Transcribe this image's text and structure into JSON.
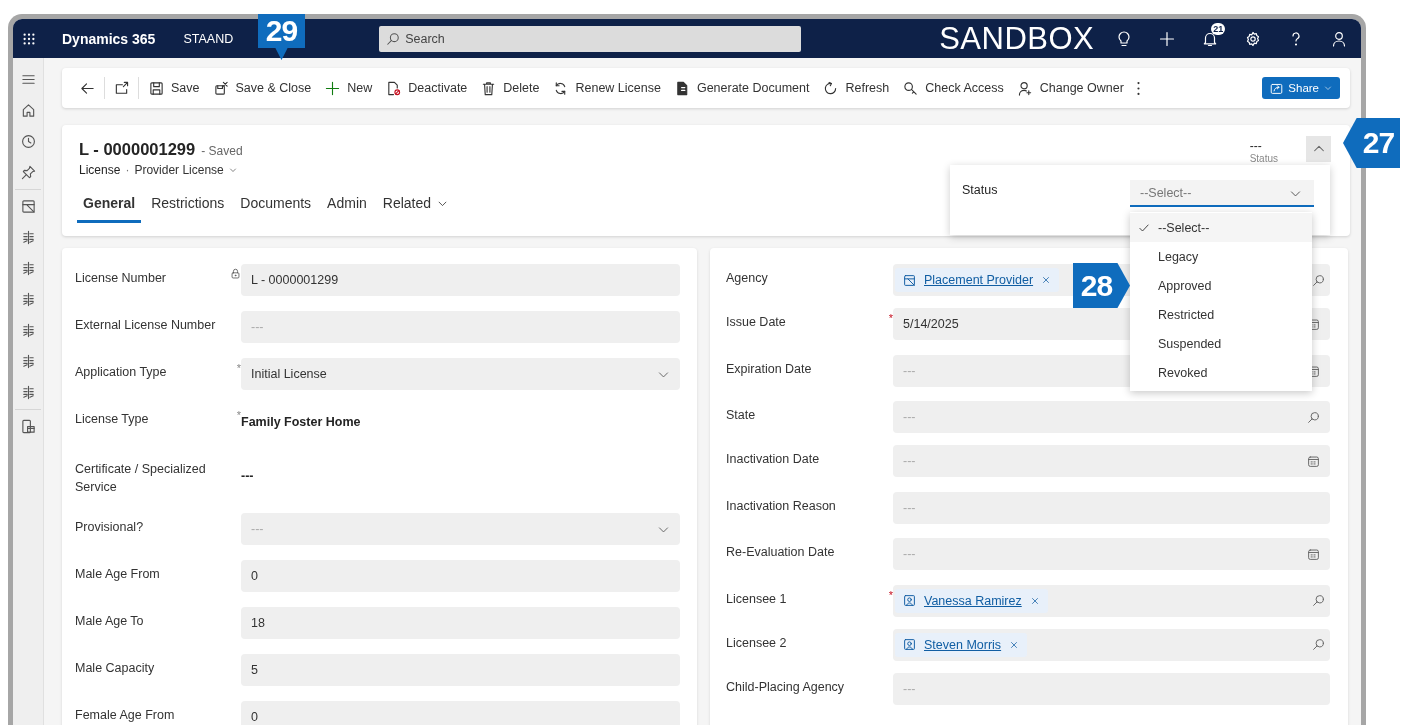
{
  "top_bar": {
    "app_name": "Dynamics 365",
    "environment": "STAAND",
    "search": {
      "placeholder": "Search"
    },
    "banner": "SANDBOX",
    "notification_count": "21"
  },
  "command_bar": {
    "commands": [
      {
        "label": "Save"
      },
      {
        "label": "Save & Close"
      },
      {
        "label": "New"
      },
      {
        "label": "Deactivate"
      },
      {
        "label": "Delete"
      },
      {
        "label": "Renew License"
      },
      {
        "label": "Generate Document"
      },
      {
        "label": "Refresh"
      },
      {
        "label": "Check Access"
      },
      {
        "label": "Change Owner"
      }
    ],
    "share": "Share"
  },
  "record": {
    "title": "L - 0000001299",
    "save_state": "- Saved",
    "entity": "License",
    "separator": "·",
    "form_name": "Provider License",
    "header_field": {
      "value": "---",
      "label": "Status"
    },
    "header_expanded": true,
    "tabs": [
      {
        "label": "General",
        "selected": true,
        "menu": false
      },
      {
        "label": "Restrictions",
        "selected": false,
        "menu": false
      },
      {
        "label": "Documents",
        "selected": false,
        "menu": false
      },
      {
        "label": "Admin",
        "selected": false,
        "menu": false
      },
      {
        "label": "Related",
        "selected": false,
        "menu": true
      }
    ]
  },
  "status_flyout": {
    "label": "Status",
    "placeholder": "--Select--",
    "options": [
      {
        "label": "--Select--",
        "selected": true
      },
      {
        "label": "Legacy",
        "selected": false
      },
      {
        "label": "Approved",
        "selected": false
      },
      {
        "label": "Restricted",
        "selected": false
      },
      {
        "label": "Suspended",
        "selected": false
      },
      {
        "label": "Revoked",
        "selected": false
      }
    ]
  },
  "form": {
    "left": [
      {
        "label": "License Number",
        "kind": "text",
        "locked": true,
        "value": "L - 0000001299"
      },
      {
        "label": "External License Number",
        "kind": "text",
        "placeholder": "---"
      },
      {
        "label": "Application Type",
        "kind": "select",
        "required_mark": "*",
        "mark_muted": true,
        "value": "Initial License"
      },
      {
        "label": "License Type",
        "kind": "plain",
        "required_mark": "*",
        "mark_muted": true,
        "value": "Family Foster Home"
      },
      {
        "label": "Certificate / Specialized Service",
        "kind": "plain",
        "value": "---"
      },
      {
        "label": "Provisional?",
        "kind": "select",
        "placeholder": "---"
      },
      {
        "label": "Male Age From",
        "kind": "text",
        "value": "0"
      },
      {
        "label": "Male Age To",
        "kind": "text",
        "value": "18"
      },
      {
        "label": "Male Capacity",
        "kind": "text",
        "value": "5"
      },
      {
        "label": "Female Age From",
        "kind": "text",
        "value": "0"
      }
    ],
    "right": [
      {
        "label": "Agency",
        "kind": "lookup",
        "value": "Placement Provider"
      },
      {
        "label": "Issue Date",
        "kind": "date",
        "required_mark": "*",
        "mark_muted": false,
        "value": "5/14/2025"
      },
      {
        "label": "Expiration Date",
        "kind": "date",
        "placeholder": "---"
      },
      {
        "label": "State",
        "kind": "lookup",
        "placeholder": "---"
      },
      {
        "label": "Inactivation Date",
        "kind": "date",
        "placeholder": "---"
      },
      {
        "label": "Inactivation Reason",
        "kind": "text",
        "placeholder": "---"
      },
      {
        "label": "Re-Evaluation Date",
        "kind": "date",
        "placeholder": "---"
      },
      {
        "label": "Licensee 1",
        "kind": "lookup",
        "required_mark": "*",
        "mark_muted": false,
        "value": "Vanessa Ramirez"
      },
      {
        "label": "Licensee 2",
        "kind": "lookup",
        "value": "Steven Morris"
      },
      {
        "label": "Child-Placing Agency",
        "kind": "text",
        "placeholder": "---"
      }
    ]
  },
  "callouts": [
    {
      "number": "29",
      "kind": "down"
    },
    {
      "number": "27",
      "kind": "left"
    },
    {
      "number": "28",
      "kind": "right"
    }
  ]
}
